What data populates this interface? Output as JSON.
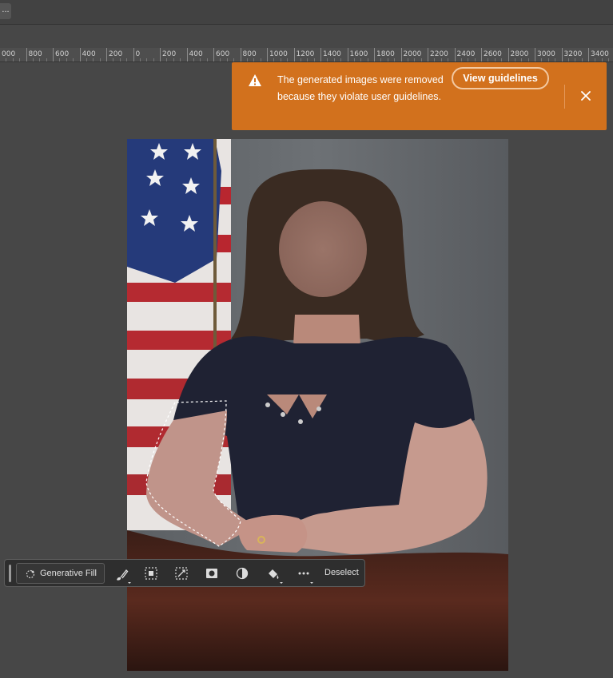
{
  "topbar": {
    "more_label": "..."
  },
  "ruler": {
    "labels": [
      "000",
      "800",
      "600",
      "400",
      "200",
      "0",
      "200",
      "400",
      "600",
      "800",
      "1000",
      "1200",
      "1400",
      "1600",
      "1800",
      "2000",
      "2200",
      "2400",
      "2600",
      "2800",
      "3000",
      "3200",
      "3400"
    ]
  },
  "notification": {
    "message": "The generated images were removed because they violate user guidelines.",
    "action_label": "View guidelines",
    "icon": "warning-icon",
    "close_icon": "close-icon",
    "bg_color": "#d2711d"
  },
  "contextual_task_bar": {
    "generative_fill_label": "Generative Fill",
    "tools": [
      "brush-icon",
      "select-subject-icon",
      "transform-selection-icon",
      "mask-icon",
      "invert-selection-icon",
      "fill-icon",
      "more-options-icon"
    ],
    "deselect_label": "Deselect"
  },
  "canvas": {
    "subject": "portrait-photo"
  }
}
